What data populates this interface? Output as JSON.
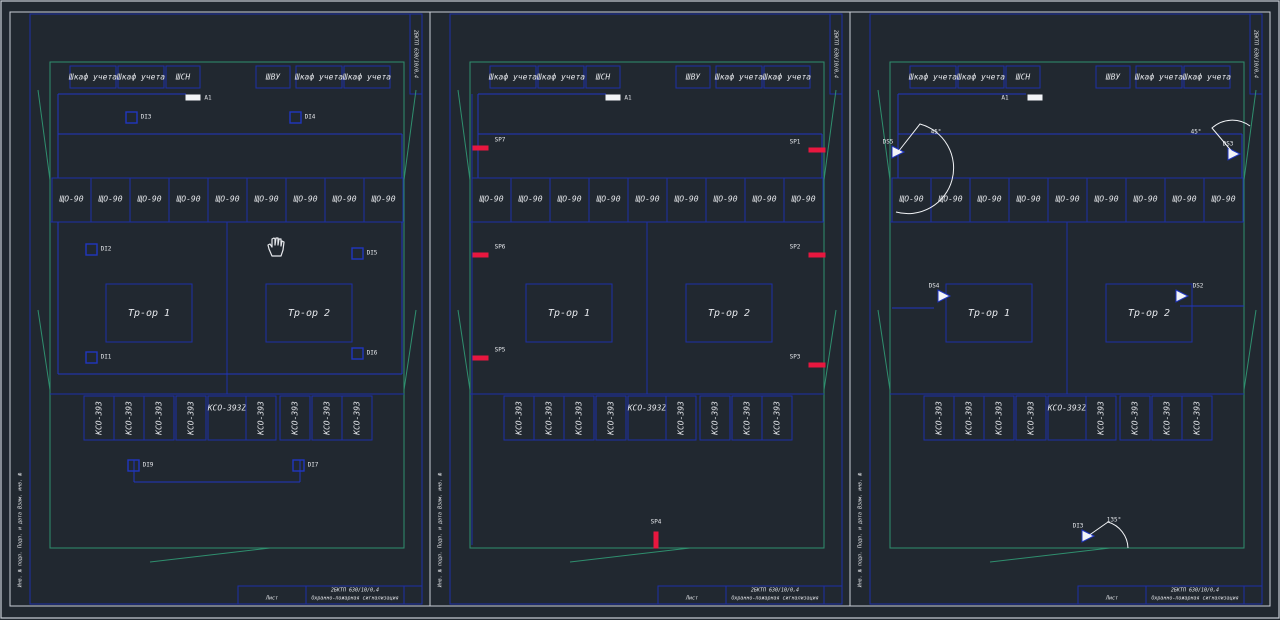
{
  "colors": {
    "background": "#212830",
    "sheet_frame": "#c9ced6",
    "inner_frame": "#1d2fa8",
    "green_boundary": "#2f8f6e",
    "wire": "#2136c0",
    "red_sensor": "#e8173f",
    "white_mark": "#f2f4f7",
    "text": "#e6e8ec"
  },
  "labels": {
    "cabinet": "Шкаф учета",
    "shn": "ШСН",
    "shvu": "ШВУ",
    "tr1": "Тр-ор 1",
    "tr2": "Тр-ор 2",
    "shchd": "ЩО-90",
    "ksd": "КСО-393",
    "ksd_h": "КСО-393Z",
    "a1": "A1"
  },
  "sheets": [
    {
      "id": "sheet-1",
      "markers": [
        "DI3",
        "DI4",
        "DI2",
        "DI5",
        "DI1",
        "DI6",
        "DI9",
        "DI7"
      ]
    },
    {
      "id": "sheet-2",
      "sensors": [
        "SP7",
        "SP1",
        "SP6",
        "SP2",
        "SP5",
        "SP3",
        "SP4"
      ]
    },
    {
      "id": "sheet-3",
      "cameras": [
        "DS5",
        "DS3",
        "DS4",
        "DS2",
        "DI3"
      ],
      "angles": [
        "45°",
        "45°",
        "135°"
      ]
    }
  ],
  "title_block": {
    "code": "2БКТП 630/10/0,4",
    "desc": "Охранно-пожарная сигнализация",
    "sheet": "Лист"
  },
  "side_text": "Инв. № подл.   Подп. и дата   Взам. инв. №"
}
